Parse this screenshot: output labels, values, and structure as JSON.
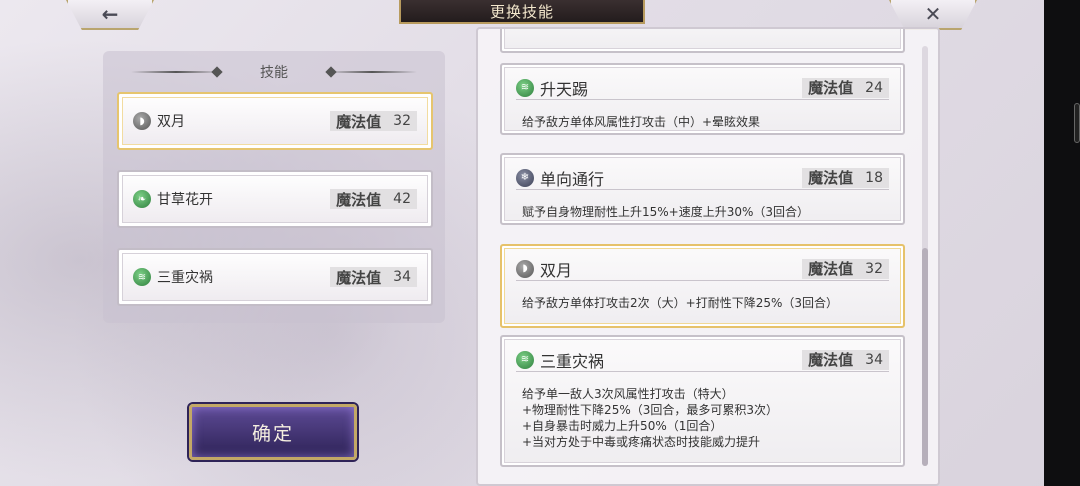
{
  "header": {
    "title": "更换技能",
    "back_icon": "←",
    "close_icon": "✕"
  },
  "left": {
    "header": "技能",
    "slots": [
      {
        "name": "双月",
        "cost_label": "魔法值",
        "cost": "32",
        "icon": "moon-icon",
        "selected": true
      },
      {
        "name": "甘草花开",
        "cost_label": "魔法值",
        "cost": "42",
        "icon": "leaf-icon",
        "selected": false
      },
      {
        "name": "三重灾祸",
        "cost_label": "魔法值",
        "cost": "34",
        "icon": "wind-icon",
        "selected": false
      }
    ],
    "confirm": "确定"
  },
  "list": {
    "skills": [
      {
        "name": "升天踢",
        "cost_label": "魔法值",
        "cost": "24",
        "icon": "wind-icon",
        "desc": [
          "给予敌方单体风属性打攻击（中）+晕眩效果"
        ]
      },
      {
        "name": "单向通行",
        "cost_label": "魔法值",
        "cost": "18",
        "icon": "snowflake-icon",
        "desc": [
          "赋予自身物理耐性上升15%+速度上升30%（3回合）"
        ]
      },
      {
        "name": "双月",
        "cost_label": "魔法值",
        "cost": "32",
        "icon": "moon-icon",
        "selected": true,
        "desc": [
          "给予敌方单体打攻击2次（大）+打耐性下降25%（3回合）"
        ]
      },
      {
        "name": "三重灾祸",
        "cost_label": "魔法值",
        "cost": "34",
        "icon": "wind-icon",
        "desc": [
          "给予单一敌人3次风属性打攻击（特大）",
          "+物理耐性下降25%（3回合，最多可累积3次）",
          "+自身暴击时威力上升50%（1回合）",
          "+当对方处于中毒或疼痛状态时技能威力提升"
        ]
      }
    ]
  },
  "colors": {
    "accent_gold": "#e6c26a",
    "confirm_purple": "#3f3173",
    "title_dark": "#2a2223"
  }
}
